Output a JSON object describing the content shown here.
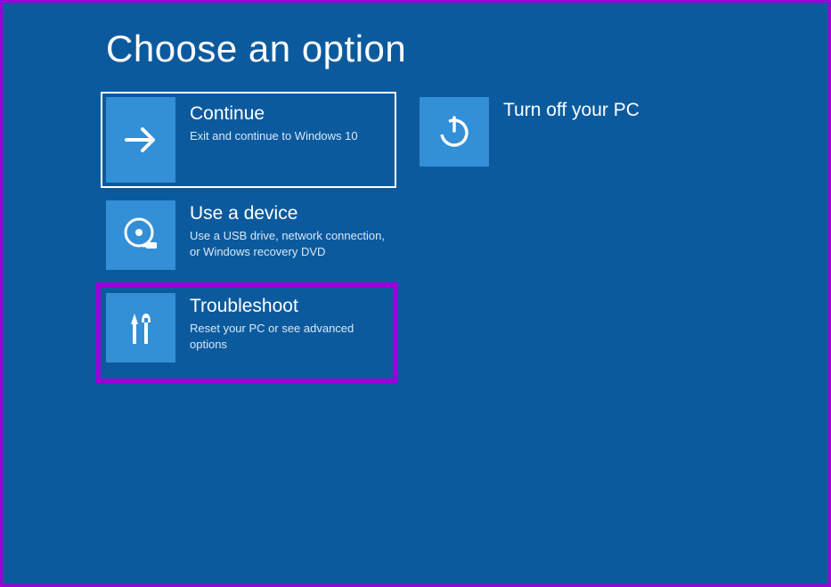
{
  "title": "Choose an option",
  "options": {
    "continue": {
      "title": "Continue",
      "desc": "Exit and continue to Windows 10"
    },
    "turnoff": {
      "title": "Turn off your PC",
      "desc": ""
    },
    "device": {
      "title": "Use a device",
      "desc": "Use a USB drive, network connection, or Windows recovery DVD"
    },
    "troubleshoot": {
      "title": "Troubleshoot",
      "desc": "Reset your PC or see advanced options"
    }
  }
}
